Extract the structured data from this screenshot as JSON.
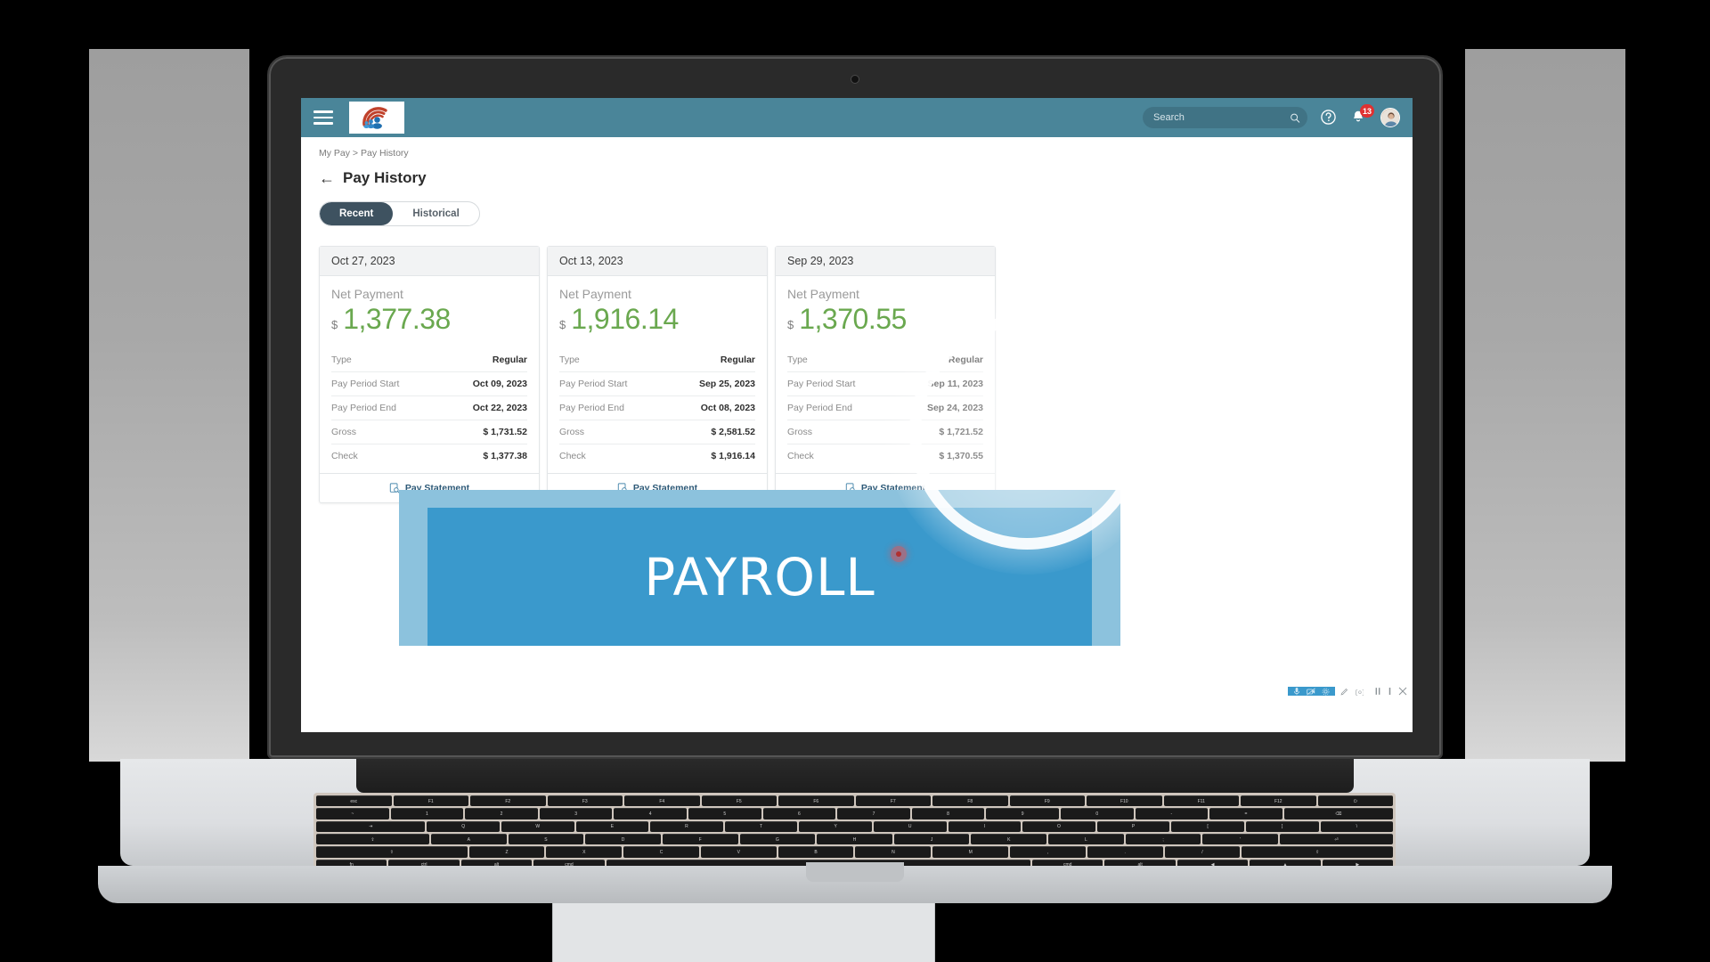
{
  "header": {
    "menu_icon": "hamburger-menu-icon",
    "logo_alt": "company-logo",
    "search": {
      "value": "",
      "placeholder": "Search",
      "icon": "search-icon"
    },
    "help_icon": "help-circle-icon",
    "notifications": {
      "icon": "bell-icon",
      "badge": "13"
    },
    "avatar_icon": "user-avatar"
  },
  "breadcrumb": "My Pay  >  Pay History",
  "page": {
    "back_arrow": "←",
    "title": "Pay History"
  },
  "tabs": [
    {
      "label": "Recent",
      "active": true
    },
    {
      "label": "Historical",
      "active": false
    }
  ],
  "card_labels": {
    "net_payment": "Net Payment",
    "currency": "$",
    "type": "Type",
    "pay_period_start": "Pay Period Start",
    "pay_period_end": "Pay Period End",
    "gross": "Gross",
    "check": "Check",
    "pay_statement": "Pay Statement",
    "statement_icon": "document-search-icon"
  },
  "cards": [
    {
      "date": "Oct 27, 2023",
      "net_payment": "1,377.38",
      "type": "Regular",
      "period_start": "Oct 09, 2023",
      "period_end": "Oct 22, 2023",
      "gross": "$ 1,731.52",
      "check": "$ 1,377.38"
    },
    {
      "date": "Oct 13, 2023",
      "net_payment": "1,916.14",
      "type": "Regular",
      "period_start": "Sep 25, 2023",
      "period_end": "Oct 08, 2023",
      "gross": "$ 2,581.52",
      "check": "$ 1,916.14"
    },
    {
      "date": "Sep 29, 2023",
      "net_payment": "1,370.55",
      "type": "Regular",
      "period_start": "Sep 11, 2023",
      "period_end": "Sep 24, 2023",
      "gross": "$ 1,721.52",
      "check": "$ 1,370.55"
    }
  ],
  "banner": {
    "text": "PAYROLL"
  },
  "video": {
    "play_icon": "play-button-overlay",
    "controls": [
      "microphone-icon",
      "camera-off-icon",
      "settings-icon",
      "pencil-icon",
      "highlight-icon",
      "pause-icon",
      "stop-icon",
      "close-icon"
    ]
  },
  "colors": {
    "header_teal": "#4a8599",
    "net_green": "#6aa84f",
    "tab_active": "#3e5260",
    "badge_red": "#e03131",
    "banner_blue": "#3a99cc",
    "banner_light": "#8cc2dd",
    "link_blue": "#2e5a78"
  }
}
